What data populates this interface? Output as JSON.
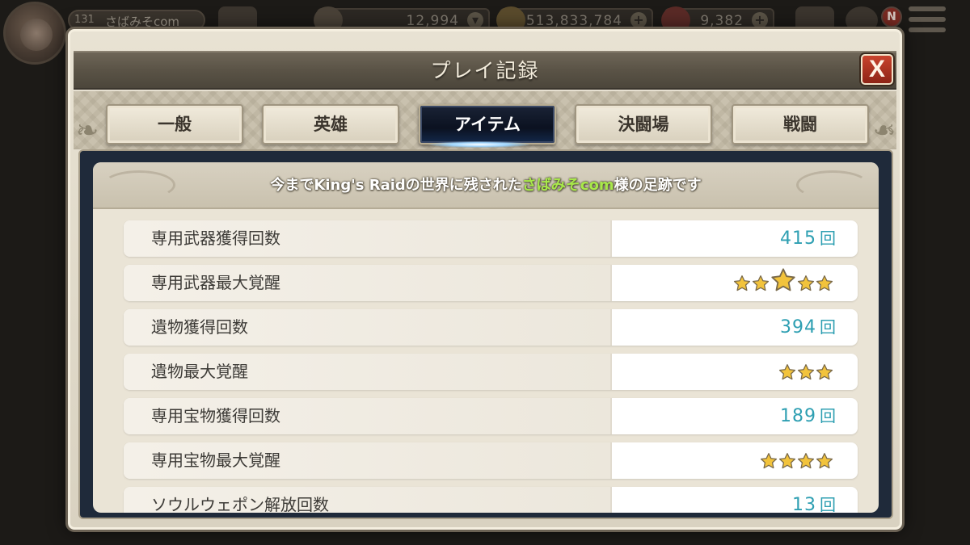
{
  "hud": {
    "player_level": "131",
    "player_name": "さばみそcom",
    "stamina": "12,994",
    "gold": "513,833,784",
    "rubies": "9,382",
    "notification_badge": "N"
  },
  "dialog": {
    "title": "プレイ記録",
    "close_label": "X"
  },
  "tabs": [
    {
      "label": "一般",
      "active": false
    },
    {
      "label": "英雄",
      "active": false
    },
    {
      "label": "アイテム",
      "active": true
    },
    {
      "label": "決闘場",
      "active": false
    },
    {
      "label": "戦闘",
      "active": false
    }
  ],
  "banner": {
    "prefix": "今までKing's Raidの世界に残された",
    "highlight": "さばみそcom",
    "suffix": "様の足跡です"
  },
  "rows": [
    {
      "label": "専用武器獲得回数",
      "value": "415",
      "unit": "回"
    },
    {
      "label": "専用武器最大覚醒",
      "stars": 5
    },
    {
      "label": "遺物獲得回数",
      "value": "394",
      "unit": "回"
    },
    {
      "label": "遺物最大覚醒",
      "stars": 3
    },
    {
      "label": "専用宝物獲得回数",
      "value": "189",
      "unit": "回"
    },
    {
      "label": "専用宝物最大覚醒",
      "stars": 4
    },
    {
      "label": "ソウルウェポン解放回数",
      "value": "13",
      "unit": "回"
    }
  ],
  "colors": {
    "value_text": "#2e9fb2",
    "highlight_name": "#a8e84a",
    "star_fill": "#f2c33c",
    "close_button": "#b2341f"
  }
}
